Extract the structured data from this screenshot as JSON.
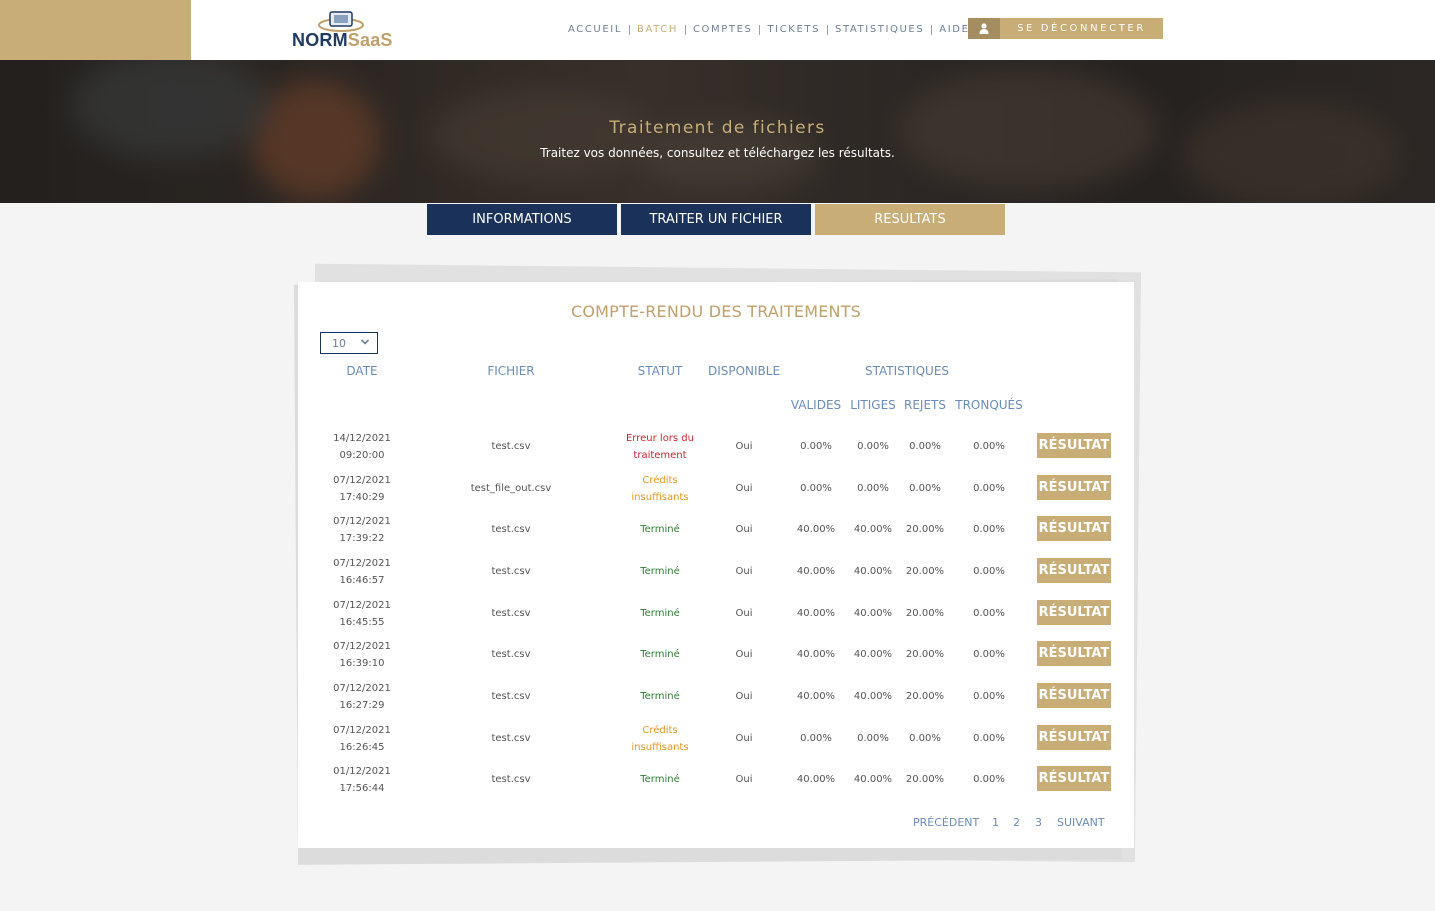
{
  "brand": {
    "name_part1": "NORM",
    "name_part2": "SaaS"
  },
  "nav": {
    "items": [
      {
        "label": "ACCUEIL",
        "active": false
      },
      {
        "label": "BATCH",
        "active": true
      },
      {
        "label": "COMPTES",
        "active": false
      },
      {
        "label": "TICKETS",
        "active": false
      },
      {
        "label": "STATISTIQUES",
        "active": false
      },
      {
        "label": "AIDE",
        "active": false
      }
    ],
    "logout_label": "SE DÉCONNECTER",
    "logout_icon": "user-icon"
  },
  "hero": {
    "title": "Traitement de fichiers",
    "subtitle": "Traitez vos données, consultez et téléchargez les résultats."
  },
  "tabs": [
    {
      "label": "INFORMATIONS",
      "active": false
    },
    {
      "label": "TRAITER UN FICHIER",
      "active": false
    },
    {
      "label": "RESULTATS",
      "active": true
    }
  ],
  "report": {
    "title": "COMPTE-RENDU DES TRAITEMENTS",
    "page_length": "10",
    "headers": {
      "date": "DATE",
      "file": "FICHIER",
      "status": "STATUT",
      "available": "DISPONIBLE",
      "stats": "STATISTIQUES",
      "valid": "VALIDES",
      "disputes": "LITIGES",
      "rejects": "REJETS",
      "truncated": "TRONQUÉS"
    },
    "result_label": "RÉSULTAT",
    "rows": [
      {
        "date": "14/12/2021",
        "time": "09:20:00",
        "file": "test.csv",
        "status_l1": "Erreur lors du",
        "status_l2": "traitement",
        "status_type": "error",
        "available": "Oui",
        "valid": "0.00%",
        "disputes": "0.00%",
        "rejects": "0.00%",
        "truncated": "0.00%"
      },
      {
        "date": "07/12/2021",
        "time": "17:40:29",
        "file": "test_file_out.csv",
        "status_l1": "Crédits",
        "status_l2": "insuffisants",
        "status_type": "warning",
        "available": "Oui",
        "valid": "0.00%",
        "disputes": "0.00%",
        "rejects": "0.00%",
        "truncated": "0.00%"
      },
      {
        "date": "07/12/2021",
        "time": "17:39:22",
        "file": "test.csv",
        "status_l1": "Terminé",
        "status_l2": "",
        "status_type": "ok",
        "available": "Oui",
        "valid": "40.00%",
        "disputes": "40.00%",
        "rejects": "20.00%",
        "truncated": "0.00%"
      },
      {
        "date": "07/12/2021",
        "time": "16:46:57",
        "file": "test.csv",
        "status_l1": "Terminé",
        "status_l2": "",
        "status_type": "ok",
        "available": "Oui",
        "valid": "40.00%",
        "disputes": "40.00%",
        "rejects": "20.00%",
        "truncated": "0.00%"
      },
      {
        "date": "07/12/2021",
        "time": "16:45:55",
        "file": "test.csv",
        "status_l1": "Terminé",
        "status_l2": "",
        "status_type": "ok",
        "available": "Oui",
        "valid": "40.00%",
        "disputes": "40.00%",
        "rejects": "20.00%",
        "truncated": "0.00%"
      },
      {
        "date": "07/12/2021",
        "time": "16:39:10",
        "file": "test.csv",
        "status_l1": "Terminé",
        "status_l2": "",
        "status_type": "ok",
        "available": "Oui",
        "valid": "40.00%",
        "disputes": "40.00%",
        "rejects": "20.00%",
        "truncated": "0.00%"
      },
      {
        "date": "07/12/2021",
        "time": "16:27:29",
        "file": "test.csv",
        "status_l1": "Terminé",
        "status_l2": "",
        "status_type": "ok",
        "available": "Oui",
        "valid": "40.00%",
        "disputes": "40.00%",
        "rejects": "20.00%",
        "truncated": "0.00%"
      },
      {
        "date": "07/12/2021",
        "time": "16:26:45",
        "file": "test.csv",
        "status_l1": "Crédits",
        "status_l2": "insuffisants",
        "status_type": "warning",
        "available": "Oui",
        "valid": "0.00%",
        "disputes": "0.00%",
        "rejects": "0.00%",
        "truncated": "0.00%"
      },
      {
        "date": "01/12/2021",
        "time": "17:56:44",
        "file": "test.csv",
        "status_l1": "Terminé",
        "status_l2": "",
        "status_type": "ok",
        "available": "Oui",
        "valid": "40.00%",
        "disputes": "40.00%",
        "rejects": "20.00%",
        "truncated": "0.00%"
      }
    ],
    "pagination": {
      "previous": "PRÉCÉDENT",
      "pages": [
        "1",
        "2",
        "3"
      ],
      "next": "SUIVANT"
    }
  },
  "colors": {
    "gold": "#c8ad77",
    "navy": "#1a3159",
    "link_blue": "#6a8cb9",
    "status_error": "#d1242c",
    "status_warning": "#e8961e",
    "status_ok": "#2e7d32"
  }
}
